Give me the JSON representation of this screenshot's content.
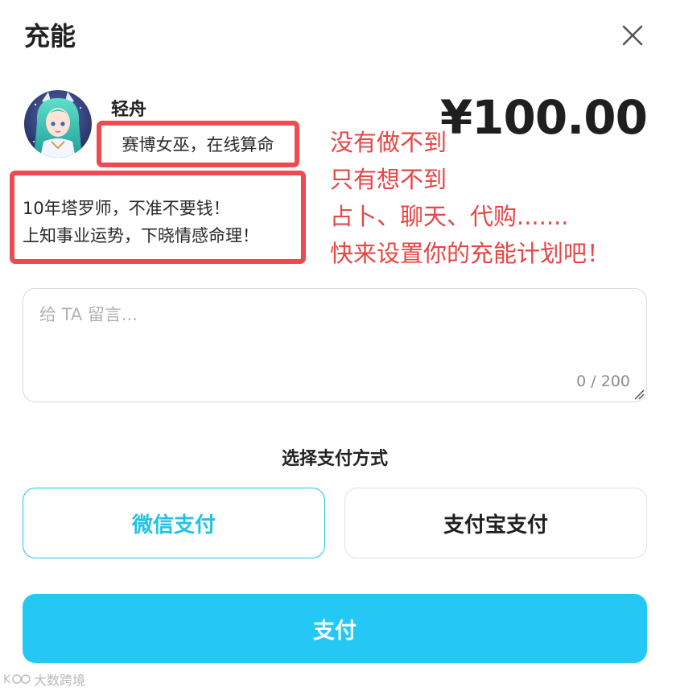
{
  "dialog": {
    "title": "充能"
  },
  "profile": {
    "name": "轻舟",
    "tagline": "赛博女巫，在线算命",
    "bio_line1": "10年塔罗师，不准不要钱！",
    "bio_line2": "上知事业运势，下晓情感命理！",
    "avatar_icon": "anime-witch-avatar"
  },
  "price": "¥100.00",
  "slogan": {
    "line1": "没有做不到",
    "line2": "只有想不到",
    "line3": "占卜、聊天、代购.......",
    "line4": "快来设置你的充能计划吧！"
  },
  "message": {
    "placeholder": "给 TA 留言...",
    "value": "",
    "counter": "0 / 200"
  },
  "payment": {
    "title": "选择支付方式",
    "options": [
      {
        "label": "微信支付",
        "selected": true
      },
      {
        "label": "支付宝支付",
        "selected": false
      }
    ]
  },
  "submit_label": "支付",
  "watermark": "大数跨境",
  "colors": {
    "accent": "#25c8f5",
    "selected_border": "#21c7e8",
    "annotation_red": "#ef4a4f"
  }
}
